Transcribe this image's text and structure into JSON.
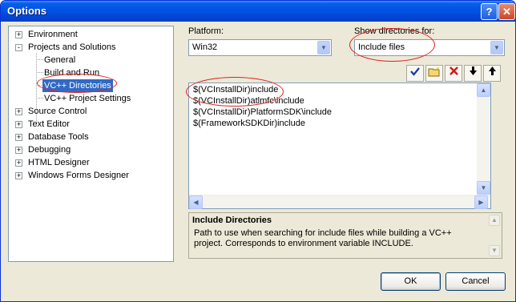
{
  "window": {
    "title": "Options",
    "help_button": "?",
    "close_button": "✕"
  },
  "tree": [
    {
      "label": "Environment",
      "expander": "+",
      "level": 0
    },
    {
      "label": "Projects and Solutions",
      "expander": "-",
      "level": 0
    },
    {
      "label": "General",
      "level": 1
    },
    {
      "label": "Build and Run",
      "level": 1
    },
    {
      "label": "VC++ Directories",
      "level": 1,
      "selected": true
    },
    {
      "label": "VC++ Project Settings",
      "level": 1
    },
    {
      "label": "Source Control",
      "expander": "+",
      "level": 0
    },
    {
      "label": "Text Editor",
      "expander": "+",
      "level": 0
    },
    {
      "label": "Database Tools",
      "expander": "+",
      "level": 0
    },
    {
      "label": "Debugging",
      "expander": "+",
      "level": 0
    },
    {
      "label": "HTML Designer",
      "expander": "+",
      "level": 0
    },
    {
      "label": "Windows Forms Designer",
      "expander": "+",
      "level": 0
    }
  ],
  "platform": {
    "label": "Platform:",
    "value": "Win32"
  },
  "show_directories": {
    "label": "Show directories for:",
    "value": "Include files"
  },
  "toolbar": {
    "check_icon": "check-icon",
    "new_folder_icon": "new-folder-icon",
    "delete_icon": "delete-icon",
    "down_icon": "move-down-icon",
    "up_icon": "move-up-icon"
  },
  "directories": [
    "$(VCInstallDir)include",
    "$(VCInstallDir)atlmfc\\include",
    "$(VCInstallDir)PlatformSDK\\include",
    "$(FrameworkSDKDir)include"
  ],
  "description": {
    "title": "Include Directories",
    "body": "Path to use when searching for include files while building a VC++ project. Corresponds to environment variable INCLUDE."
  },
  "buttons": {
    "ok": "OK",
    "cancel": "Cancel"
  },
  "colors": {
    "title_bar": "#0055e5",
    "selection": "#316ac5",
    "annotation_circle": "#e02020"
  }
}
